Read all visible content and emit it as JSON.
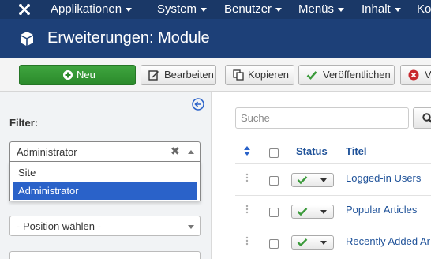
{
  "nav": {
    "items": [
      {
        "label": "Applikationen"
      },
      {
        "label": "System"
      },
      {
        "label": "Benutzer"
      },
      {
        "label": "Menüs"
      },
      {
        "label": "Inhalt"
      },
      {
        "label": "Ko"
      }
    ]
  },
  "page": {
    "title": "Erweiterungen: Module"
  },
  "toolbar": {
    "new_label": "Neu",
    "edit_label": "Bearbeiten",
    "copy_label": "Kopieren",
    "publish_label": "Veröffentlichen",
    "unpublish_label": "Ve"
  },
  "sidebar": {
    "filter_label": "Filter:",
    "client_select": {
      "value": "Administrator",
      "options": [
        "Site",
        "Administrator"
      ],
      "selected": "Administrator"
    },
    "position_select": {
      "value": "- Position wählen -"
    }
  },
  "main": {
    "search": {
      "placeholder": "Suche"
    },
    "columns": {
      "status": "Status",
      "title": "Titel"
    },
    "rows": [
      {
        "title": "Logged-in Users",
        "published": true
      },
      {
        "title": "Popular Articles",
        "published": true
      },
      {
        "title": "Recently Added Ar",
        "published": true
      }
    ]
  },
  "colors": {
    "nav_bg": "#1a3867",
    "title_bg": "#1d4078",
    "new_button": "#3fa53f",
    "link": "#1f5299",
    "selected_option": "#2a62c9",
    "published_check": "#3a9a3a"
  }
}
